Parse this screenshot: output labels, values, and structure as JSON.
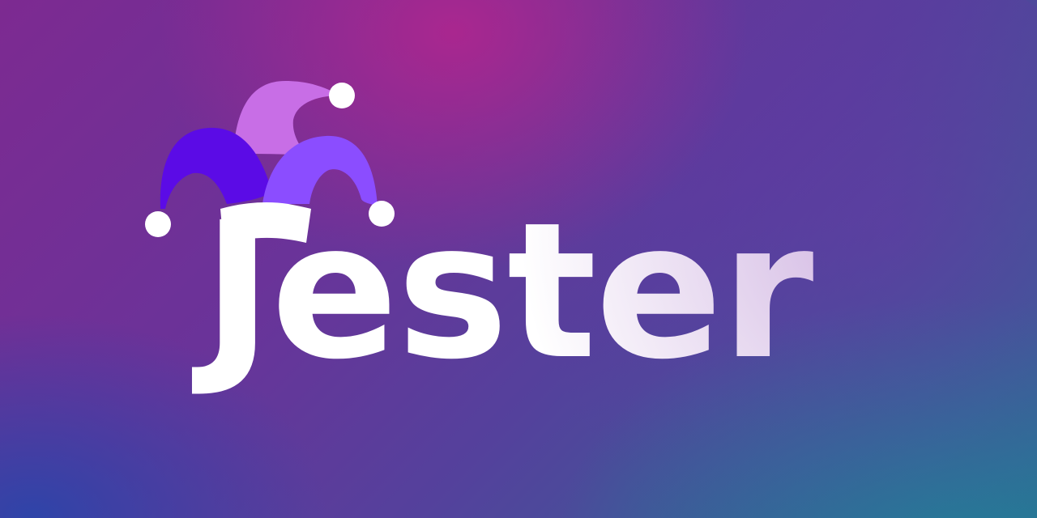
{
  "brand": {
    "name": "Jester"
  },
  "colors": {
    "background_top": "#7d2a91",
    "background_bottom": "#2f6b93",
    "hat_center": "#c86ee6",
    "hat_left": "#5b0be6",
    "hat_right": "#8b4dff",
    "bells": "#ffffff",
    "text": "#ffffff"
  },
  "icons": {
    "logo": "jester-hat-icon"
  }
}
